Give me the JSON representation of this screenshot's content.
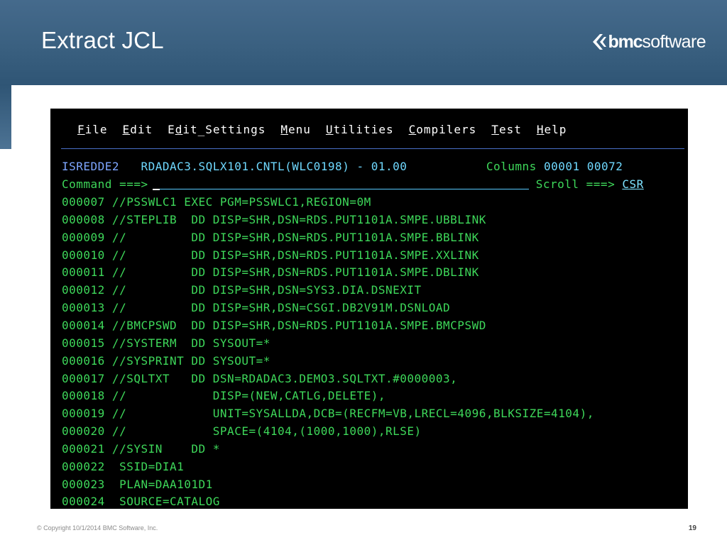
{
  "slide": {
    "title": "Extract JCL",
    "logo": {
      "strong": "bmc",
      "light": "software"
    },
    "copyright": "© Copyright 10/1/2014 BMC Software, Inc.",
    "page_number": "19"
  },
  "terminal": {
    "menu": [
      {
        "u": "F",
        "rest": "ile"
      },
      {
        "u": "E",
        "rest": "dit"
      },
      {
        "pre": "E",
        "u": "d",
        "rest": "it_Settings"
      },
      {
        "u": "M",
        "rest": "enu"
      },
      {
        "u": "U",
        "rest": "tilities"
      },
      {
        "u": "C",
        "rest": "ompilers"
      },
      {
        "u": "T",
        "rest": "est"
      },
      {
        "u": "H",
        "rest": "elp"
      }
    ],
    "panel_id": "ISREDDE2",
    "dataset": "RDADAC3.SQLX101.CNTL(WLC0198) - 01.00",
    "columns_label": "Columns",
    "columns_from": "00001",
    "columns_to": "00072",
    "command_label": "Command ===>",
    "command_value": "",
    "scroll_label": "Scroll ===>",
    "scroll_value": "CSR",
    "lines": [
      "000007 //PSSWLC1 EXEC PGM=PSSWLC1,REGION=0M",
      "000008 //STEPLIB  DD DISP=SHR,DSN=RDS.PUT1101A.SMPE.UBBLINK",
      "000009 //         DD DISP=SHR,DSN=RDS.PUT1101A.SMPE.BBLINK",
      "000010 //         DD DISP=SHR,DSN=RDS.PUT1101A.SMPE.XXLINK",
      "000011 //         DD DISP=SHR,DSN=RDS.PUT1101A.SMPE.DBLINK",
      "000012 //         DD DISP=SHR,DSN=SYS3.DIA.DSNEXIT",
      "000013 //         DD DISP=SHR,DSN=CSGI.DB2V91M.DSNLOAD",
      "000014 //BMCPSWD  DD DISP=SHR,DSN=RDS.PUT1101A.SMPE.BMCPSWD",
      "000015 //SYSTERM  DD SYSOUT=*",
      "000016 //SYSPRINT DD SYSOUT=*",
      "000017 //SQLTXT   DD DSN=RDADAC3.DEMO3.SQLTXT.#0000003,",
      "000018 //            DISP=(NEW,CATLG,DELETE),",
      "000019 //            UNIT=SYSALLDA,DCB=(RECFM=VB,LRECL=4096,BLKSIZE=4104),",
      "000020 //            SPACE=(4104,(1000,1000),RLSE)",
      "000021 //SYSIN    DD *",
      "000022  SSID=DIA1",
      "000023  PLAN=DAA101D1",
      "000024  SOURCE=CATALOG"
    ]
  }
}
